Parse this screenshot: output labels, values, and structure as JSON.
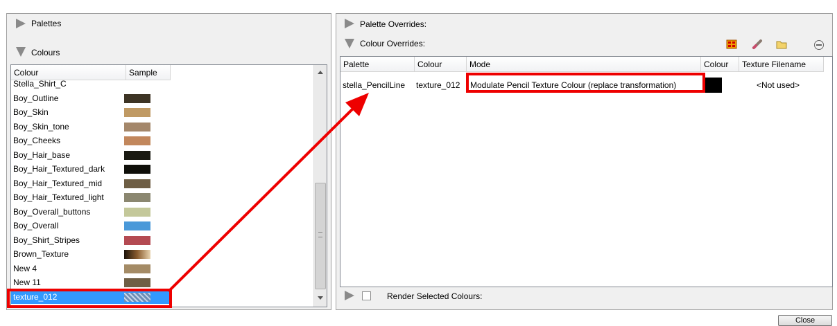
{
  "palettes_panel": {
    "title": "Palettes"
  },
  "colours_panel": {
    "title": "Colours",
    "columns": [
      "Colour",
      "Sample"
    ],
    "rows": [
      {
        "name": "Stella_Shirt_C",
        "swatch": "#ffffff"
      },
      {
        "name": "Boy_Outline",
        "swatch": "#3d3425"
      },
      {
        "name": "Boy_Skin",
        "swatch": "#c09a64"
      },
      {
        "name": "Boy_Skin_tone",
        "swatch": "#a4876a"
      },
      {
        "name": "Boy_Cheeks",
        "swatch": "#c2875c"
      },
      {
        "name": "Boy_Hair_base",
        "swatch": "#1a1a12"
      },
      {
        "name": "Boy_Hair_Textured_dark",
        "swatch": "#0f0f0a"
      },
      {
        "name": "Boy_Hair_Textured_mid",
        "swatch": "#6e5e44"
      },
      {
        "name": "Boy_Hair_Textured_light",
        "swatch": "#8b8770"
      },
      {
        "name": "Boy_Overall_buttons",
        "swatch": "#c4c89a"
      },
      {
        "name": "Boy_Overall",
        "swatch": "#4a99d9"
      },
      {
        "name": "Boy_Shirt_Stripes",
        "swatch": "#b44a52"
      },
      {
        "name": "Brown_Texture",
        "swatch": "linear-gradient(90deg,#1b120a,#8a5c2e,#e8d4b0)"
      },
      {
        "name": "New 4",
        "swatch": "#a48b66"
      },
      {
        "name": "New 11",
        "swatch": "#6e5e44"
      },
      {
        "name": "texture_012",
        "swatch": "repeating-linear-gradient(45deg,#6e8fb8 0 3px,#c7d6ea 3px 5px)"
      }
    ],
    "selected": "texture_012"
  },
  "palette_overrides_panel": {
    "title": "Palette Overrides:"
  },
  "colour_overrides_panel": {
    "title": "Colour Overrides:",
    "columns": [
      "Palette",
      "Colour",
      "Mode",
      "Colour",
      "Texture Filename"
    ],
    "rows": [
      {
        "palette": "stella_PencilLine",
        "colour": "texture_012",
        "mode": "Modulate Pencil Texture Colour (replace transformation)",
        "swatch": "#000000",
        "texture_filename": "<Not used>"
      }
    ]
  },
  "render_selected": {
    "label": "Render Selected Colours:"
  },
  "close_button": {
    "label": "Close"
  },
  "colors": {
    "highlight": "#3399ff",
    "annotation_red": "#ee0000"
  }
}
